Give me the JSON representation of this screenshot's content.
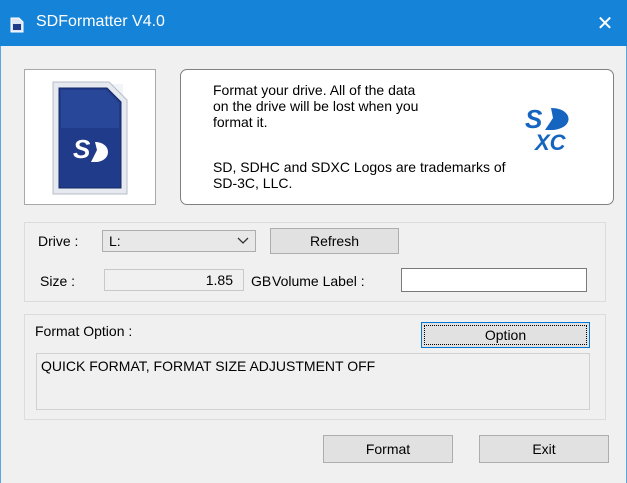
{
  "window": {
    "title": "SDFormatter V4.0",
    "close_glyph": "✕"
  },
  "info": {
    "lines": [
      "Format your drive. All of the data",
      "on the drive will be lost when you",
      "format it.",
      "SD, SDHC and SDXC Logos are trademarks of",
      "SD-3C, LLC."
    ],
    "logo_text_top": "S",
    "logo_text_bottom": "XC",
    "card_logo_text": "S"
  },
  "drive": {
    "label": "Drive :",
    "selected": "L:",
    "refresh_label": "Refresh",
    "size_label": "Size  :",
    "size_value": "1.85",
    "size_unit": "GB",
    "volume_label": "Volume Label  :",
    "volume_value": ""
  },
  "format_option": {
    "label": "Format Option :",
    "option_button": "Option",
    "status": "QUICK FORMAT, FORMAT SIZE ADJUSTMENT OFF"
  },
  "actions": {
    "format_label": "Format",
    "exit_label": "Exit"
  },
  "colors": {
    "titlebar": "#1583d7",
    "card_blue": "#1f3b8a",
    "logo_blue": "#1565c0"
  }
}
